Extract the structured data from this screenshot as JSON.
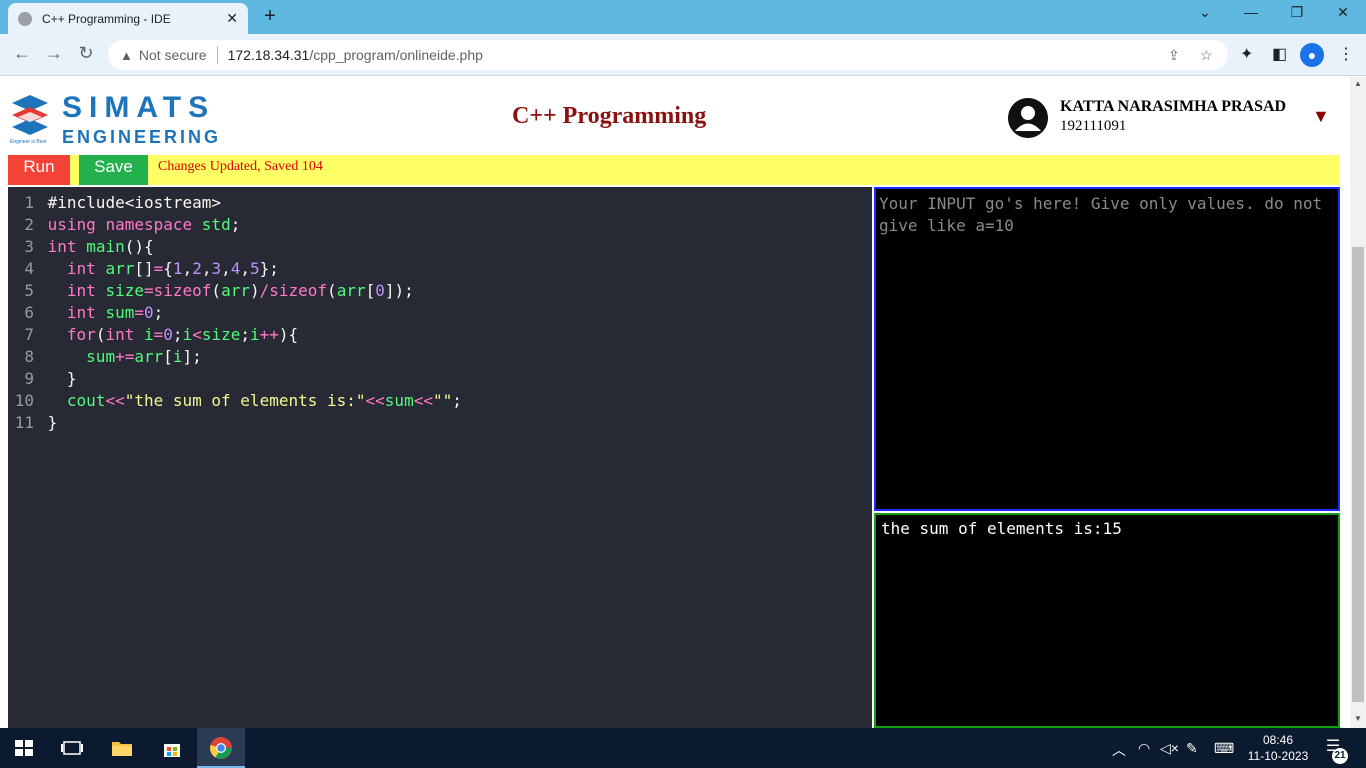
{
  "browser": {
    "tab_title": "C++ Programming - IDE",
    "tab_close": "✕",
    "new_tab": "+",
    "win_min": "—",
    "win_restore": "❐",
    "win_close": "✕",
    "win_menu": "⌄",
    "back": "←",
    "forward": "→",
    "reload": "↻",
    "security_label": "Not secure",
    "url_host": "172.18.34.31",
    "url_path": "/cpp_program/onlineide.php"
  },
  "header": {
    "logo_name": "SIMATS",
    "logo_sub": "ENGINEERING",
    "logo_tagline": "Engineer is Best",
    "title": "C++ Programming",
    "user_name": "KATTA NARASIMHA PRASAD",
    "user_id": "192111091",
    "dropdown_caret": "▼"
  },
  "toolbar": {
    "run_label": "Run",
    "save_label": "Save",
    "status": "Changes Updated, Saved 104"
  },
  "editor": {
    "line_numbers": [
      "1",
      "2",
      "3",
      "4",
      "5",
      "6",
      "7",
      "8",
      "9",
      "10",
      "11"
    ]
  },
  "input": {
    "placeholder": "Your INPUT go's here! Give only values. do not give like a=10"
  },
  "output": {
    "text": "the sum of elements is:15"
  },
  "taskbar": {
    "time": "08:46",
    "date": "11-10-2023",
    "notification_count": "21"
  },
  "colors": {
    "run": "#f44336",
    "save": "#22b14c",
    "toolbar_bg": "#ffff66",
    "title": "#8b1010",
    "input_border": "#1c2bff",
    "output_border": "#14a014"
  }
}
